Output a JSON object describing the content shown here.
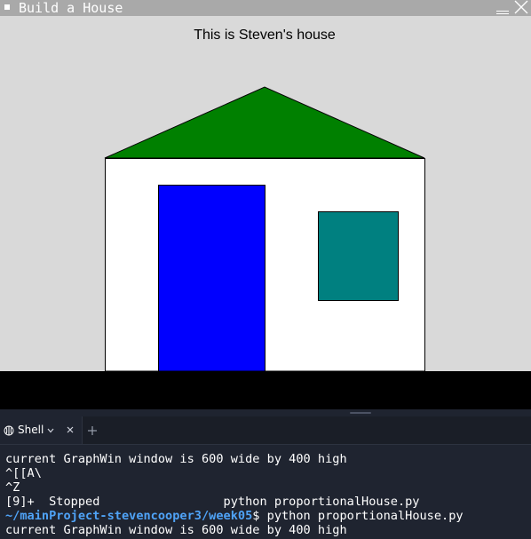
{
  "window": {
    "title": "Build a House",
    "icon": "window-menu-icon",
    "minimize_icon": "minimize-icon",
    "close_icon": "close-icon"
  },
  "graph": {
    "caption": "This is Steven's house",
    "background_color": "#d9d9d9",
    "ground_color": "#000000",
    "roof_color": "#008000",
    "wall_color": "#ffffff",
    "door_color": "#0000ff",
    "window_color": "#008080"
  },
  "shell": {
    "tab_label": "Shell",
    "tab_icon": "shell-icon",
    "dropdown_icon": "chevron-down-icon",
    "tab_close_icon": "close-icon",
    "add_tab_icon": "plus-icon",
    "lines": [
      "current GraphWin window is 600 wide by 400 high",
      "^[[A\\",
      "^Z",
      "[9]+  Stopped                 python proportionalHouse.py"
    ],
    "prompt_path": "~/mainProject-stevencooper3/week05",
    "prompt_command": "$ python proportionalHouse.py",
    "last_line": "current GraphWin window is 600 wide by 400 high"
  },
  "colors": {
    "titlebar": "#a9a9a9",
    "terminal_bg": "#1f2430",
    "terminal_text": "#ffffff",
    "prompt_path": "#4fa3f7"
  }
}
